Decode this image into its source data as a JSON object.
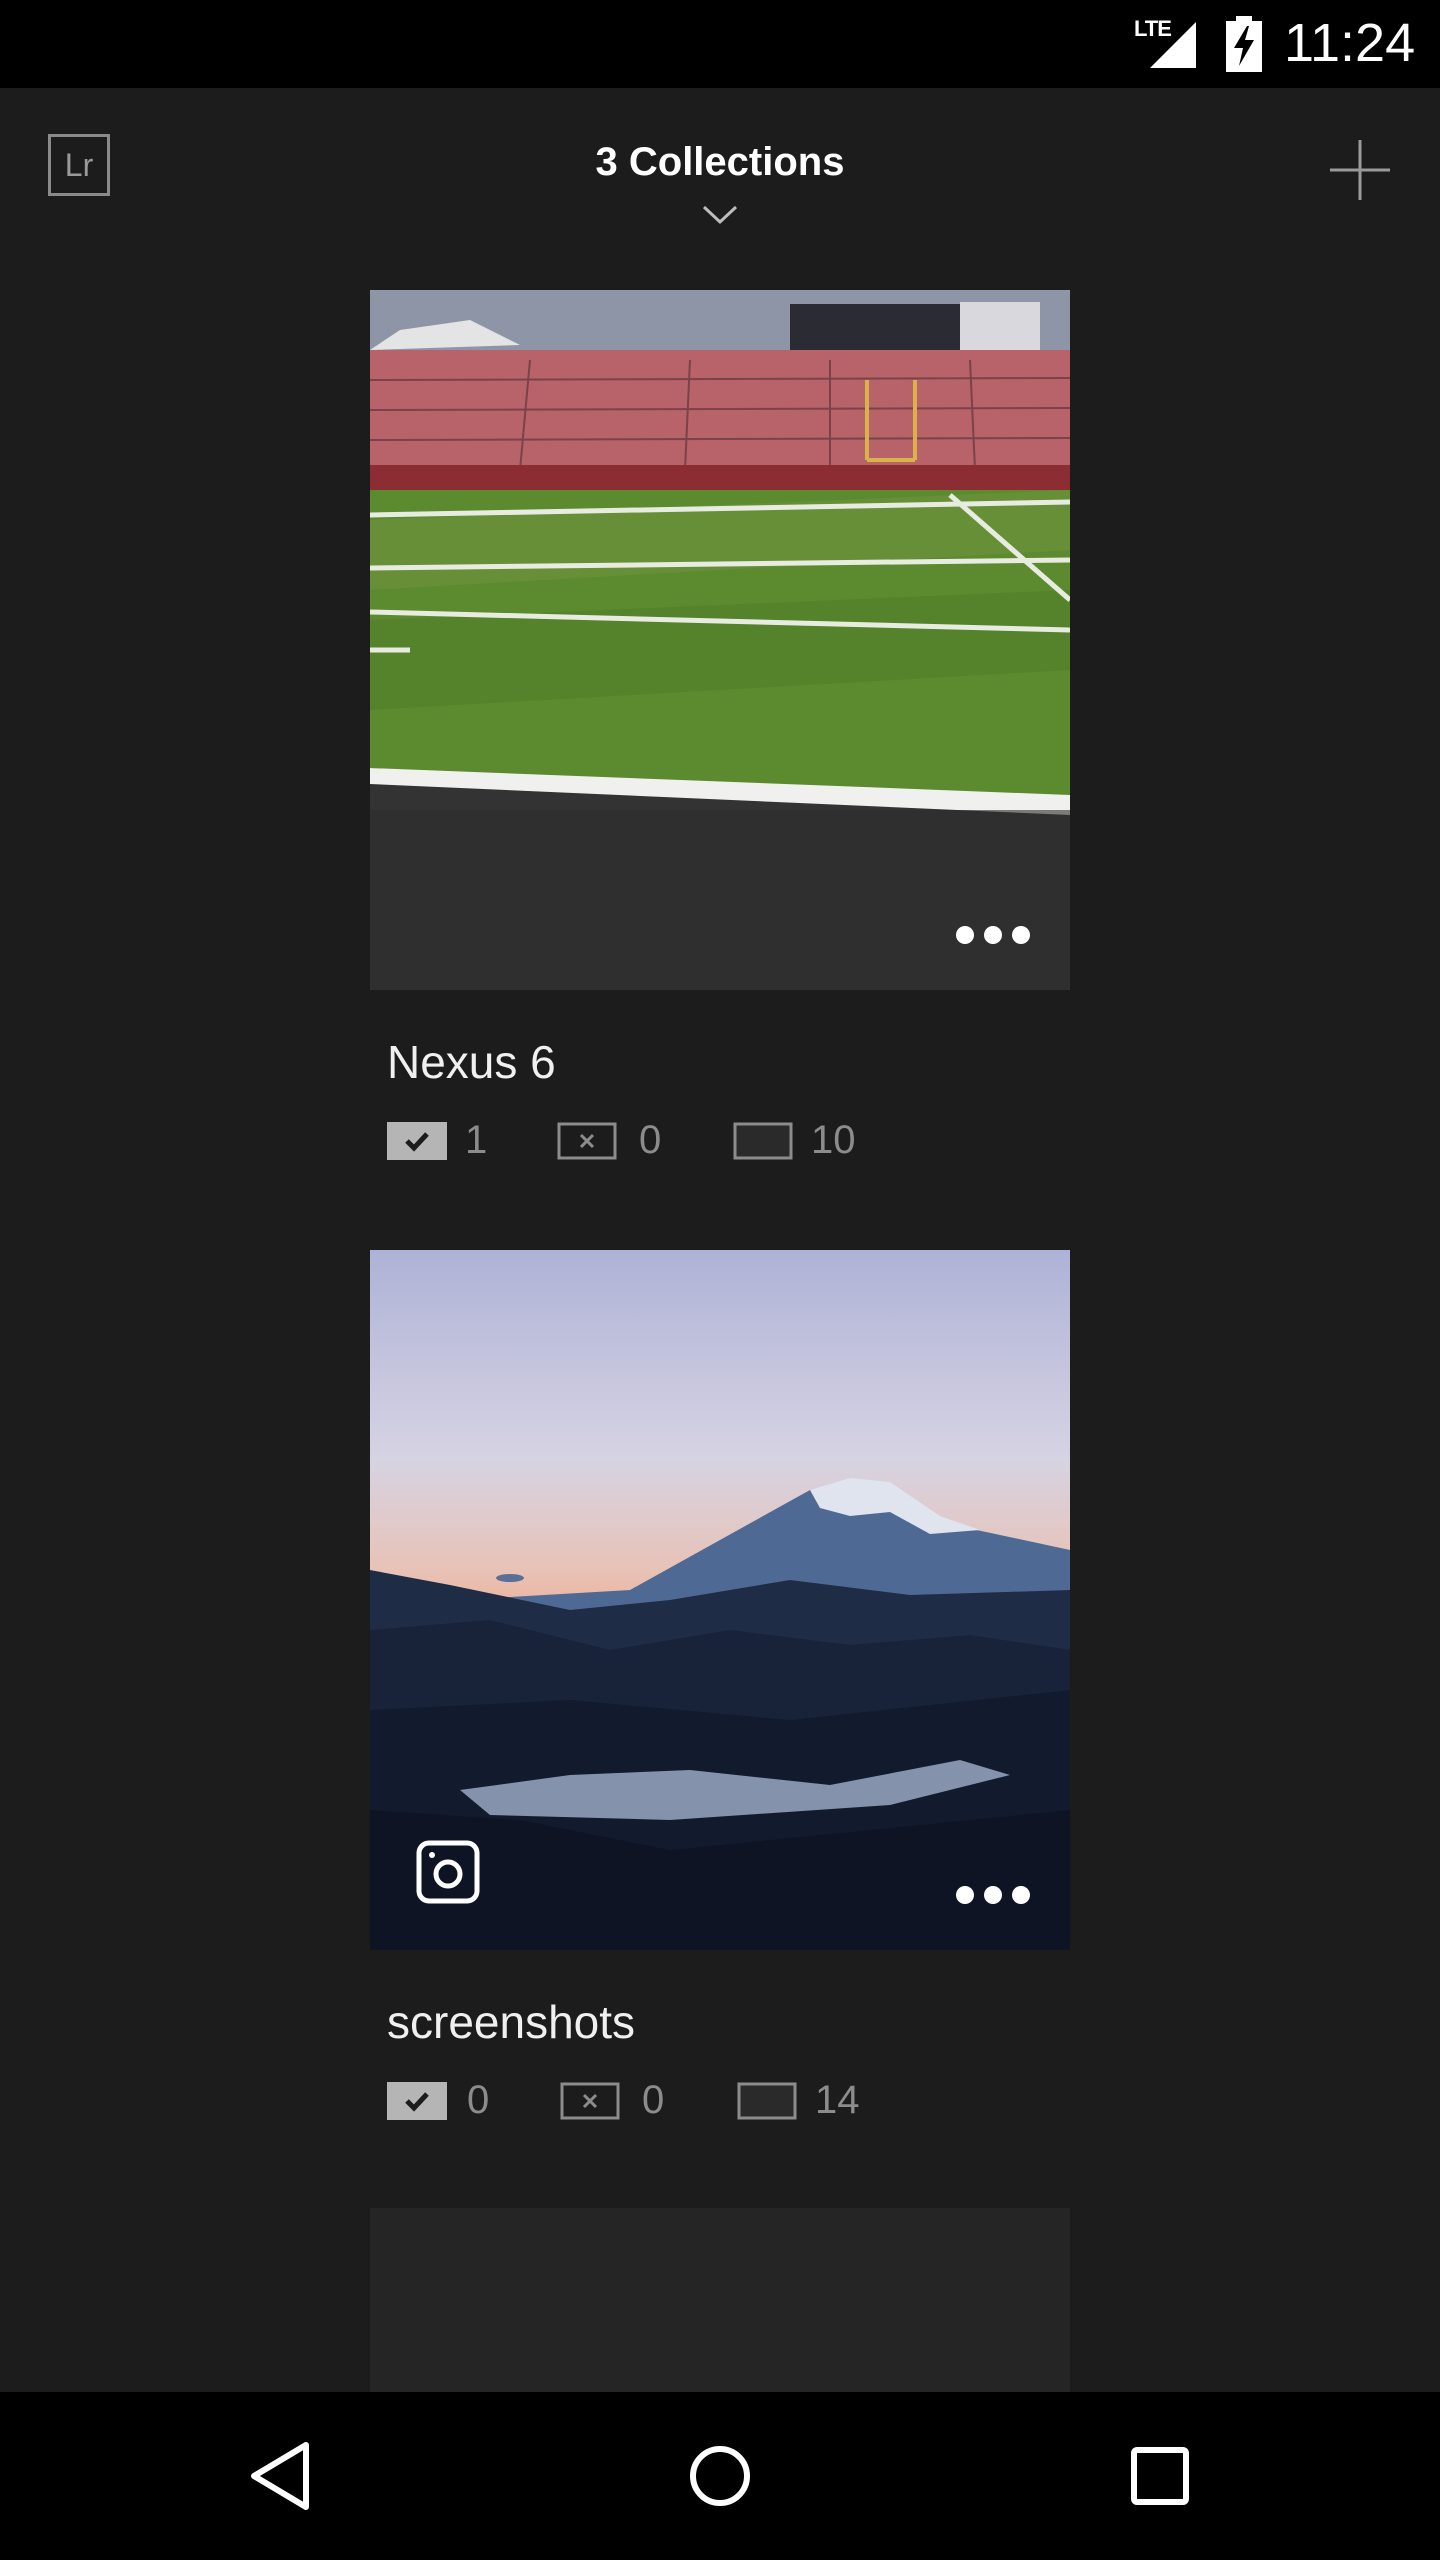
{
  "status_bar": {
    "network": "LTE",
    "time": "11:24"
  },
  "header": {
    "title": "3 Collections"
  },
  "collections": [
    {
      "name": "Nexus 6",
      "picked": "1",
      "rejected": "0",
      "total": "10",
      "photo": "football-stadium-field",
      "badge": null
    },
    {
      "name": "screenshots",
      "picked": "0",
      "rejected": "0",
      "total": "14",
      "photo": "mountain-sunrise",
      "badge": "screenshot-icon"
    }
  ],
  "icons": {
    "logo": "Lr",
    "add": "plus-icon",
    "menu": "more-icon",
    "picked": "check-flag-icon",
    "rejected": "reject-flag-icon",
    "total": "photo-frame-icon"
  },
  "colors": {
    "background": "#1c1c1c",
    "status_bar": "#000000",
    "text": "#f0f0f0",
    "muted": "#8c8c8c"
  }
}
